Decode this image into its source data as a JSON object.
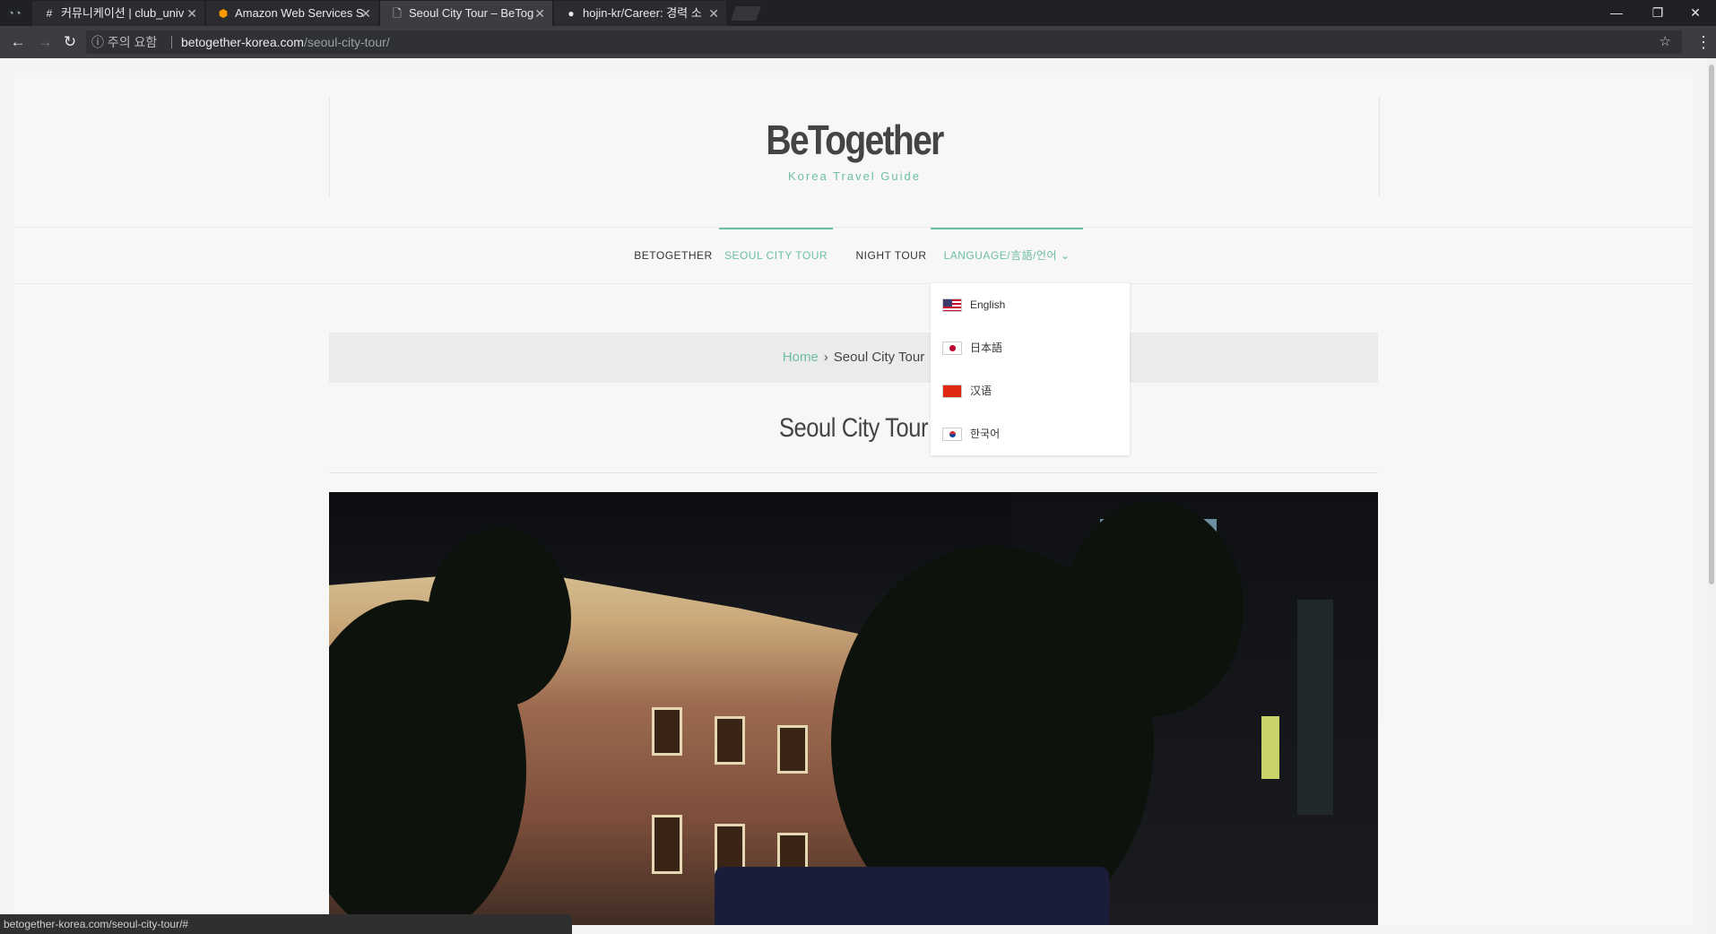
{
  "browser": {
    "tabs": [
      {
        "icon": "#",
        "title": "커뮤니케이션 | club_univ",
        "active": false
      },
      {
        "icon": "⬢",
        "title": "Amazon Web Services S",
        "active": false
      },
      {
        "icon": "🗋",
        "title": "Seoul City Tour – BeTog",
        "active": true
      },
      {
        "icon": "●",
        "title": "hojin-kr/Career: 경력 소",
        "active": false
      }
    ],
    "close_glyph": "✕",
    "security_label": "ⓘ 주의 요함",
    "url_host": "betogether-korea.com",
    "url_path": "/seoul-city-tour/",
    "status_url": "betogether-korea.com/seoul-city-tour/#"
  },
  "site": {
    "logo": "BeTogether",
    "tagline": "Korea Travel Guide",
    "nav": [
      {
        "label": "BETOGETHER"
      },
      {
        "label": "SEOUL CITY TOUR"
      },
      {
        "label": "NIGHT TOUR"
      },
      {
        "label": "LANGUAGE/言語/언어 ⌄"
      }
    ],
    "language_menu": [
      {
        "label": "English",
        "flag": "us-flag-icon"
      },
      {
        "label": "日本語",
        "flag": "japan-flag-icon"
      },
      {
        "label": "汉语",
        "flag": "china-flag-icon"
      },
      {
        "label": "한국어",
        "flag": "korea-flag-icon"
      }
    ],
    "breadcrumb": {
      "home": "Home",
      "separator": "›",
      "current": "Seoul City Tour"
    },
    "page_title": "Seoul City Tour"
  },
  "colors": {
    "accent": "#6cbf9f"
  }
}
